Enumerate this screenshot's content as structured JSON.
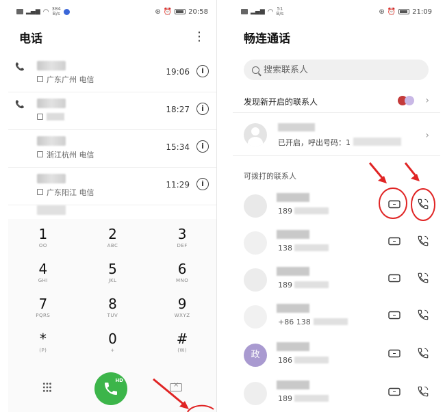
{
  "colors": {
    "call_green": "#3cb54a",
    "annotation_red": "#e02424",
    "avatar_purple": "#a99ad0"
  },
  "left": {
    "status": {
      "time": "20:58",
      "speed_value": "384",
      "speed_unit": "B/s"
    },
    "title": "电话",
    "calls": [
      {
        "location": "广东广州 电信",
        "time": "19:06"
      },
      {
        "location": "",
        "time": "18:27"
      },
      {
        "location": "浙江杭州 电信",
        "time": "15:34"
      },
      {
        "location": "广东阳江 电信",
        "time": "11:29"
      }
    ],
    "keys": [
      {
        "digit": "1",
        "letters": "OO"
      },
      {
        "digit": "2",
        "letters": "ABC"
      },
      {
        "digit": "3",
        "letters": "DEF"
      },
      {
        "digit": "4",
        "letters": "GHI"
      },
      {
        "digit": "5",
        "letters": "JKL"
      },
      {
        "digit": "6",
        "letters": "MNO"
      },
      {
        "digit": "7",
        "letters": "PQRS"
      },
      {
        "digit": "8",
        "letters": "TUV"
      },
      {
        "digit": "9",
        "letters": "WXYZ"
      },
      {
        "digit": "*",
        "letters": "(P)"
      },
      {
        "digit": "0",
        "letters": "+"
      },
      {
        "digit": "#",
        "letters": "(W)"
      }
    ],
    "call_badge": "HD"
  },
  "right": {
    "status": {
      "time": "21:09",
      "speed_value": "51",
      "speed_unit": "B/s"
    },
    "title": "畅连通话",
    "search_placeholder": "搜索联系人",
    "discover_text": "发现新开启的联系人",
    "me_status": "已开启，呼出号码：1",
    "section_label": "可拨打的联系人",
    "contacts": [
      {
        "number": "189",
        "avatar": ""
      },
      {
        "number": "138",
        "avatar": ""
      },
      {
        "number": "189",
        "avatar": ""
      },
      {
        "number": "+86 138",
        "avatar": ""
      },
      {
        "number": "186",
        "avatar": "政"
      },
      {
        "number": "189",
        "avatar": ""
      }
    ]
  }
}
